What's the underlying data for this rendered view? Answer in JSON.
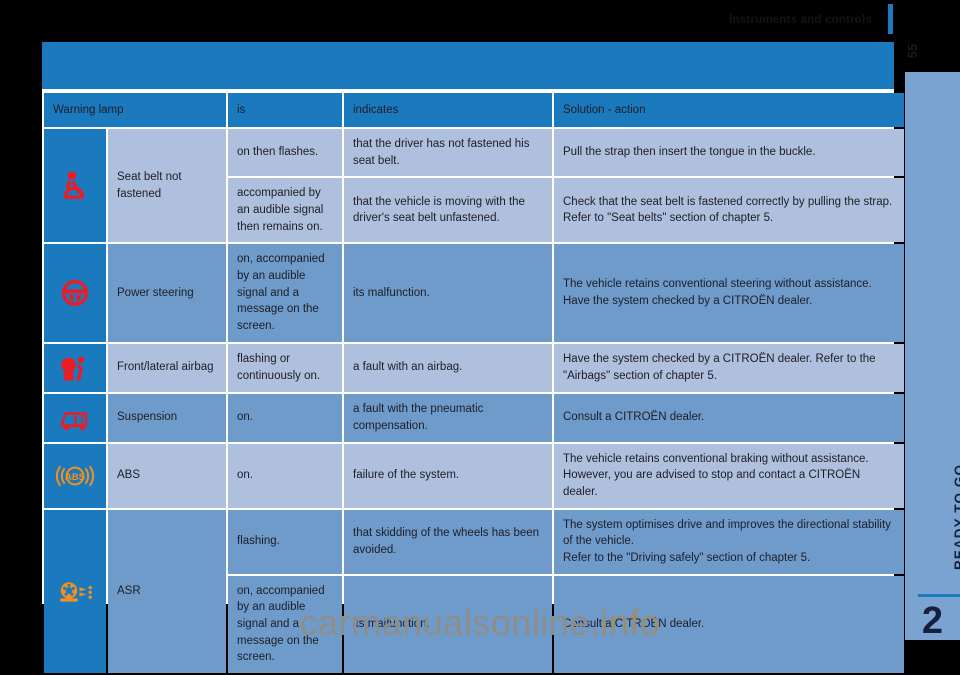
{
  "header": {
    "running_head": "Instruments and controls",
    "folio": "55"
  },
  "chapter_tab": {
    "label": "READY TO GO",
    "number": "2"
  },
  "watermark": {
    "name": "carmanualsonline",
    "domain": ".info"
  },
  "colors": {
    "brand_blue": "#1b79bd",
    "row_light": "#aec0dd",
    "row_dark": "#6f9bcb",
    "tab_blue": "#7ba3d2",
    "icon_red": "#ed1b24",
    "icon_orange": "#f5901e",
    "text": "#1d1d26"
  },
  "table": {
    "columns": [
      "Warning lamp",
      "is",
      "indicates",
      "Solution - action"
    ],
    "rows": [
      {
        "icon": "seat-belt-icon",
        "icon_color": "#ed1b24",
        "name": "Seat belt not fastened",
        "shade": "light",
        "lines": [
          {
            "is": "on then flashes.",
            "indicates": "that the driver has not fastened his seat belt.",
            "solution": "Pull the strap then insert the tongue in the buckle."
          },
          {
            "is": "accompanied by an audible signal then remains on.",
            "indicates": "that the vehicle is moving with the driver's seat belt unfastened.",
            "solution": "Check that the seat belt is fastened correctly by pulling the strap. Refer to \"Seat belts\" section of chapter 5."
          }
        ]
      },
      {
        "icon": "steering-wheel-icon",
        "icon_color": "#ed1b24",
        "name": "Power steering",
        "shade": "dark",
        "lines": [
          {
            "is": "on, accompanied by an audible signal and a message on the screen.",
            "is_small": true,
            "indicates": "its malfunction.",
            "solution": "The vehicle retains conventional steering without assistance. Have the system checked by a CITROËN dealer."
          }
        ]
      },
      {
        "icon": "airbag-icon",
        "icon_color": "#ed1b24",
        "name": "Front/lateral airbag",
        "shade": "light",
        "lines": [
          {
            "is": "flashing or continuously on.",
            "indicates": "a fault with an airbag.",
            "solution": "Have the system checked by a CITROËN dealer. Refer to the \"Airbags\" section of chapter 5."
          }
        ]
      },
      {
        "icon": "suspension-icon",
        "icon_color": "#ed1b24",
        "name": "Suspension",
        "shade": "dark",
        "lines": [
          {
            "is": "on.",
            "indicates": "a fault with the pneumatic compensation.",
            "solution": "Consult a CITROËN dealer."
          }
        ]
      },
      {
        "icon": "abs-icon",
        "icon_color": "#f5901e",
        "name": "ABS",
        "shade": "light",
        "lines": [
          {
            "is": "on.",
            "indicates": "failure of the system.",
            "solution": "The vehicle retains conventional braking without assistance. However, you are advised to stop and contact a CITROËN dealer."
          }
        ]
      },
      {
        "icon": "asr-icon",
        "icon_color": "#f5901e",
        "name": "ASR",
        "shade": "dark",
        "lines": [
          {
            "is": "flashing.",
            "indicates": "that skidding of the wheels has been avoided.",
            "solution": "The system optimises drive and improves the directional stability of the vehicle.\nRefer to the \"Driving safely\" section of chapter 5."
          },
          {
            "is": "on, accompanied by an audible signal and a message on the screen.",
            "is_small": true,
            "indicates": "its malfunction.",
            "solution": "Consult a CITROËN dealer."
          }
        ]
      }
    ]
  }
}
